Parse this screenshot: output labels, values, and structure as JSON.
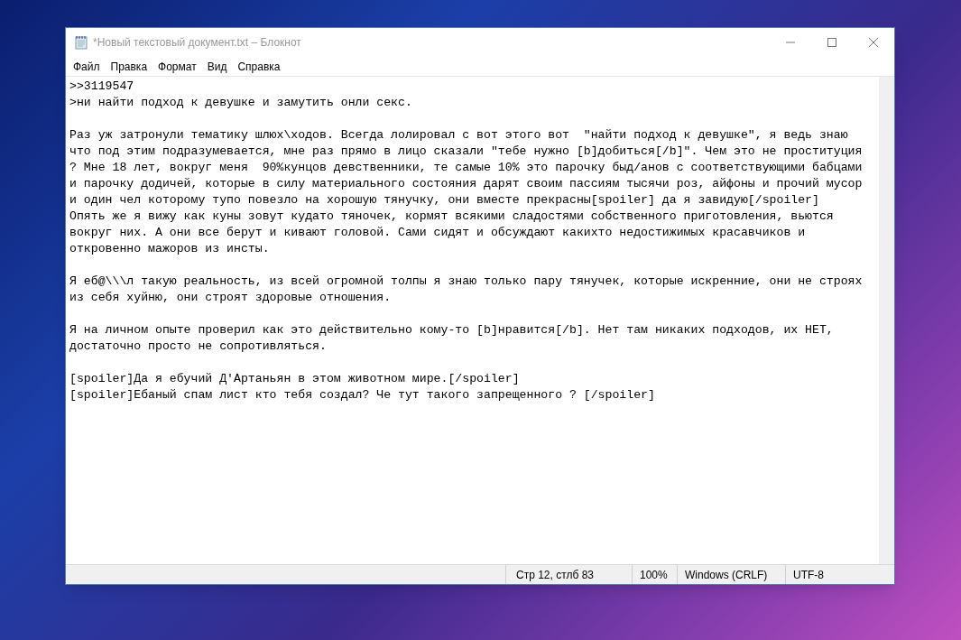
{
  "window": {
    "title": "*Новый текстовый документ.txt – Блокнот"
  },
  "menu": [
    "Файл",
    "Правка",
    "Формат",
    "Вид",
    "Справка"
  ],
  "document": {
    "paragraphs": [
      [
        ">>3119547",
        ">ни найти подход к девушке и замутить онли секс."
      ],
      [
        "Раз уж затронули тематику шлюх\\ходов. Всегда лолировал с вот этого вот  \"найти подход к девушке\", я ведь знаю",
        "что под этим подразумевается, мне раз прямо в лицо сказали \"тебе нужно [b]добиться[/b]\". Чем это не проституция",
        "? Мне 18 лет, вокруг меня  90%кунцов девственники, те самые 10% это парочку быд/анов с соответствующими бабцами",
        "и парочку додичей, которые в силу материального состояния дарят своим пассиям тысячи роз, айфоны и прочий мусор",
        "и один чел которому тупо повезло на хорошую тянучку, они вместе прекрасны[spoiler] да я завидую[/spoiler]",
        "Опять же я вижу как куны зовут кудато тяночек, кормят всякими сладостями собственного приготовления, вьются",
        "вокруг них. А они все берут и кивают головой. Сами сидят и обсуждают какихто недостижимых красавчиков и",
        "откровенно мажоров из инсты."
      ],
      [
        "Я еб@\\\\\\л такую реальность, из всей огромной толпы я знаю только пару тянучек, которые искренние, они не строях",
        "из себя хуйню, они строят здоровые отношения."
      ],
      [
        "Я на личном опыте проверил как это действительно кому-то [b]нравится[/b]. Нет там никаких подходов, их НЕТ,",
        "достаточно просто не сопротивляться."
      ],
      [
        "[spoiler]Да я ебучий Д'Артаньян в этом животном мире.[/spoiler]",
        "[spoiler]Ебаный спам лист кто тебя создал? Че тут такого запрещенного ? [/spoiler]"
      ]
    ]
  },
  "status_bar": {
    "position": "Стр 12, стлб 83",
    "zoom": "100%",
    "line_endings": "Windows (CRLF)",
    "encoding": "UTF-8"
  }
}
